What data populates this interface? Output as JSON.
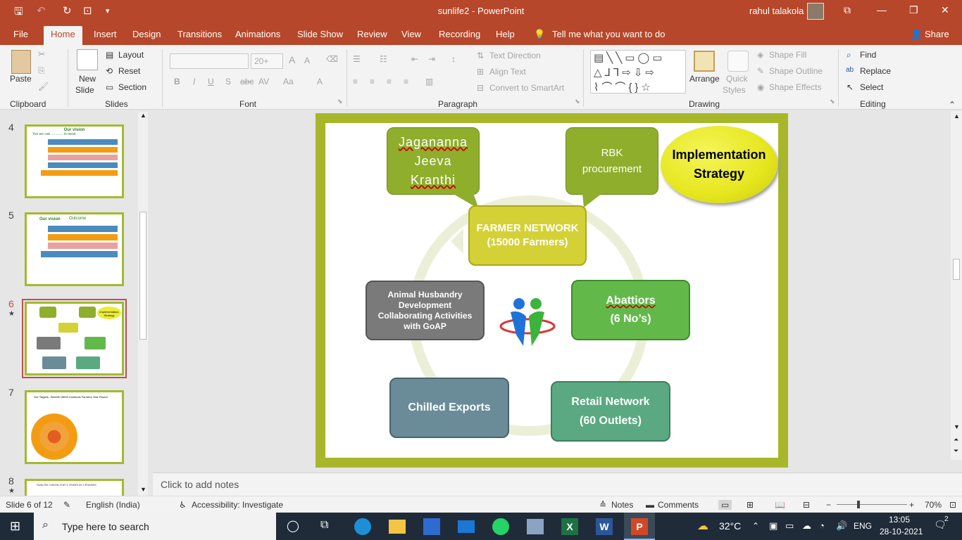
{
  "window": {
    "title": "sunlife2  -  PowerPoint",
    "user": "rahul talakola"
  },
  "tabs": [
    "File",
    "Home",
    "Insert",
    "Design",
    "Transitions",
    "Animations",
    "Slide Show",
    "Review",
    "View",
    "Recording",
    "Help",
    "Tell me what you want to do"
  ],
  "share": "Share",
  "ribbon": {
    "paste": "Paste",
    "new_slide": "New",
    "new_slide2": "Slide",
    "layout": "Layout",
    "reset": "Reset",
    "section": "Section",
    "font_size": "20+",
    "text_direction": "Text Direction",
    "align_text": "Align Text",
    "convert_smartart": "Convert to SmartArt",
    "arrange": "Arrange",
    "quick_styles": "Quick",
    "quick_styles2": "Styles",
    "shape_fill": "Shape Fill",
    "shape_outline": "Shape Outline",
    "shape_effects": "Shape Effects",
    "find": "Find",
    "replace": "Replace",
    "select": "Select",
    "groups": {
      "clipboard": "Clipboard",
      "slides": "Slides",
      "font": "Font",
      "paragraph": "Paragraph",
      "drawing": "Drawing",
      "editing": "Editing"
    }
  },
  "thumbnails": [
    {
      "num": "4",
      "title": "Our vision",
      "sub": "Yes we can ............ in meat"
    },
    {
      "num": "5",
      "title": "Our vision",
      "sub": "Outcome"
    },
    {
      "num": "6",
      "title": "Implementation Strategy",
      "sub": ""
    },
    {
      "num": "7",
      "title": "Our Targets : Benefit 15000 Livestock Farmers Year Round",
      "sub": ""
    },
    {
      "num": "8",
      "title": "SUNLIFE VISION FOR 3 YEARS IN 3 PHASES",
      "sub": ""
    }
  ],
  "slide": {
    "bubble1": [
      "Jagananna",
      "Jeeva",
      "Kranthi"
    ],
    "bubble2": [
      "RBK",
      "procurement"
    ],
    "implementation": [
      "Implementation",
      "Strategy"
    ],
    "farmer": [
      "FARMER NETWORK",
      "(15000 Farmers)"
    ],
    "animal": [
      "Animal Husbandry",
      "Development",
      "Collaborating Activities",
      "with GoAP"
    ],
    "abattoirs": [
      "Abattiors",
      "(6 No’s)"
    ],
    "chilled": "Chilled Exports",
    "retail": [
      "Retail Network",
      "(60 Outlets)"
    ]
  },
  "notes_placeholder": "Click to add notes",
  "status": {
    "slide": "Slide 6 of 12",
    "language": "English (India)",
    "accessibility": "Accessibility: Investigate",
    "notes": "Notes",
    "comments": "Comments",
    "zoom": "70%"
  },
  "taskbar": {
    "search": "Type here to search",
    "weather": "32°C",
    "lang": "ENG",
    "time": "13:05",
    "date": "28-10-2021",
    "notifications": "2"
  },
  "colors": {
    "accent": "#b7472a",
    "slide_frame": "#a7b729",
    "farmer": "#d4d136",
    "green_box": "#62b94a",
    "gray_box": "#7a7a7a",
    "teal_box": "#6a8c99",
    "retail_box": "#5aa982"
  }
}
